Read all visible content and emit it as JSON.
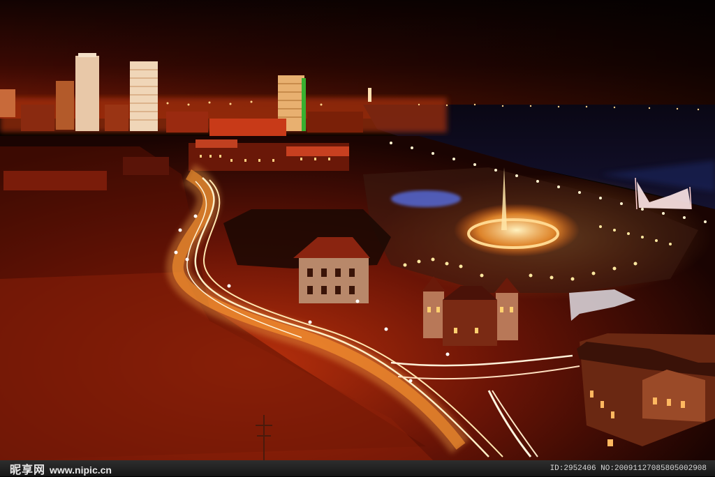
{
  "image": {
    "description_type": "night aerial city waterfront"
  },
  "watermark": {
    "logo_text": "昵享网",
    "url_text": "www.nipic.cn"
  },
  "footer": {
    "id_text": "ID:2952406 NO:20091127085805002908"
  },
  "colors": {
    "sky_top": "#140402",
    "sky_horizon": "#6a1404",
    "light_trail": "#ffe6b0",
    "ground_glow": "#8a1e08",
    "water": "#0c0a1e"
  }
}
